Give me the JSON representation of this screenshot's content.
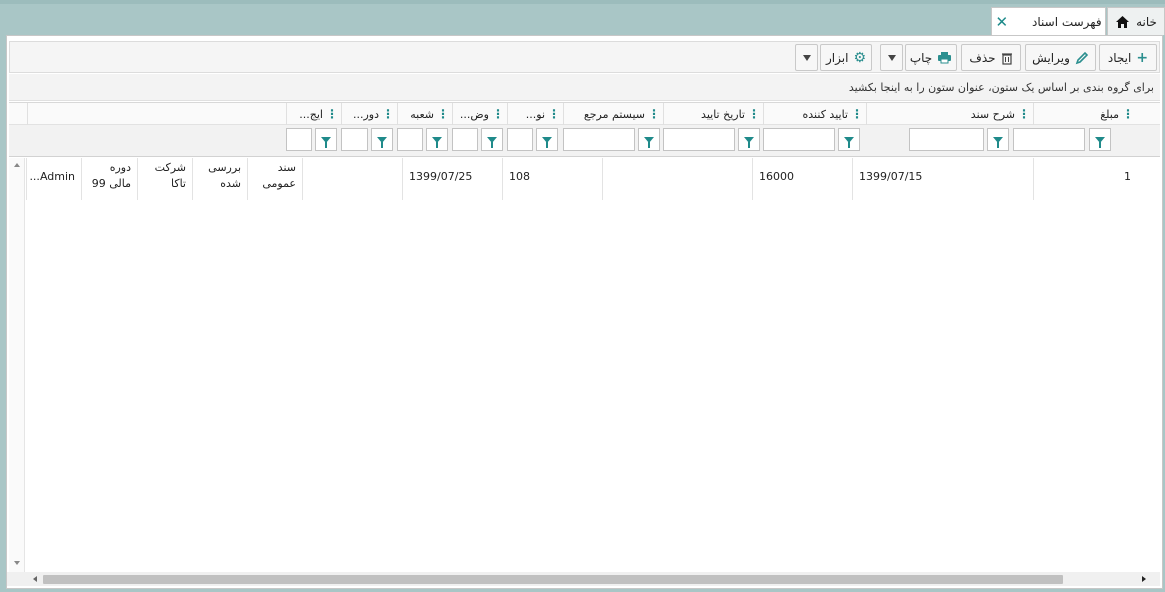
{
  "tabs": {
    "home": "خانه",
    "active": "فهرست اسناد",
    "close_icon": "close-icon",
    "home_icon": "home-icon"
  },
  "toolbar": {
    "create": "ایجاد",
    "edit": "ویرایش",
    "delete": "حذف",
    "print": "چاپ",
    "tools": "ابزار"
  },
  "group_hint": "برای گروه بندی بر اساس یک ستون، عنوان ستون را به اینجا بکشید",
  "columns": [
    "مبلغ",
    "شرح سند",
    "تایید کننده",
    "تاریخ تایید",
    "سیستم مرجع",
    "نو...",
    "وض...",
    "شعبه",
    "دور...",
    "ایج...",
    ""
  ],
  "rows": [
    {
      "amount": "1",
      "description": "1399/07/15",
      "approver": "16000",
      "approve_date": "",
      "ref_system": "108",
      "type": "1399/07/25",
      "status": "",
      "branch": "سند عمومی",
      "period": "بررسی شده",
      "creator": "شرکت تاکا",
      "extra1": "دوره مالی 99",
      "extra2": "Admin..."
    }
  ],
  "colors": {
    "accent": "#1f8a8a",
    "background": "#a9c6c6"
  }
}
